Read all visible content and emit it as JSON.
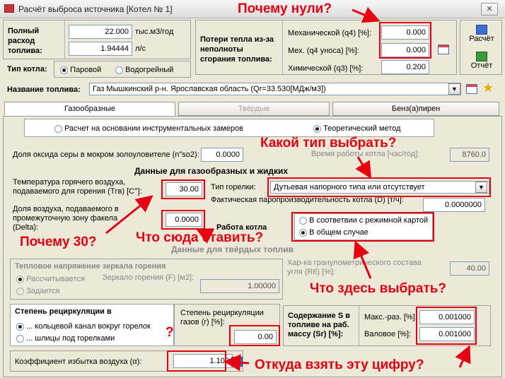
{
  "window": {
    "title": "Расчёт выброса источника [Котел № 1]",
    "close": "✕"
  },
  "fuel": {
    "label_line1": "Полный",
    "label_line2": "расход",
    "label_line3": "топлива:",
    "value1": "22.000",
    "unit1": "тыс.м3/год",
    "value2": "1.94444",
    "unit2": "л/с"
  },
  "boiler_type": {
    "label": "Тип котла:",
    "opt1": "Паровой",
    "opt2": "Водогрейный",
    "selected": "Паровой"
  },
  "heat_loss": {
    "label_line1": "Потери тепла из-за",
    "label_line2": "неполноты",
    "label_line3": "сгорания топлива:",
    "mech_label": "Механической (q4) [%]:",
    "mech_value": "0.000",
    "mech_carry_label": "Мех. (q4 уноса) [%]:",
    "mech_carry_value": "0.000",
    "chem_label": "Химической (q3) [%]:",
    "chem_value": "0.200"
  },
  "actions": {
    "calc": "Расчёт",
    "report": "Отчёт"
  },
  "fuel_name": {
    "label": "Название топлива:",
    "value": "Газ Мышкинский р-н. Ярославская область (Qr=33.530[МДж/м3])"
  },
  "tabs": [
    {
      "label": "Газообразные",
      "state": "active"
    },
    {
      "label": "Твёрдые",
      "state": "disabled"
    },
    {
      "label": "Бенз(а)пирен",
      "state": "normal"
    }
  ],
  "method": {
    "opt1": "Расчет на основании инструментальных замеров",
    "opt2": "Теоретический метод",
    "selected": "Теоретический метод"
  },
  "sulfur": {
    "label": "Доля оксида серы в мокром золоуловителе (n\"so2):",
    "value": "0.0000"
  },
  "work_time": {
    "label": "Время работы котла [час/год]:",
    "value": "8760.0"
  },
  "section_gas": "Данные для газообразных и жидких",
  "air_temp": {
    "label_line1": "Температура горячего воздуха,",
    "label_line2": "подаваемого для горения (Tгв) [C°]:",
    "value": "30.00"
  },
  "burner": {
    "label": "Тип горелки:",
    "value": "Дутьевая напорного типа или отсутствует"
  },
  "steam": {
    "label": "Фактическая паропроизводительность котла (D) [т/ч]:",
    "value": "0.0000000"
  },
  "delta": {
    "label_line1": "Доля воздуха, подаваемого в",
    "label_line2": "промежуточную зону факела",
    "label_line3": "(Delta):",
    "value": "0.0000"
  },
  "boiler_work": {
    "label": "Работа котла",
    "opt1": "В соответвии с режимной картой",
    "opt2": "В общем случае",
    "selected": "В общем случае"
  },
  "section_solid": "Данные для твёрдых топлив",
  "thermal": {
    "label": "Тепловое напряжение зеркала горения",
    "opt1": "Рассчитывается",
    "opt2": "Задается",
    "mirror_label": "Зеркало горения (F) [м2]:",
    "mirror_value": "1.00000"
  },
  "granulometry": {
    "label_line1": "Хар-ка гранулометрического состава",
    "label_line2": "угля (R6) [%]:",
    "value": "40.00"
  },
  "recirc": {
    "label": "Степень рециркуляции в",
    "opt1": "... кольцевой канал вокруг горелок",
    "opt2": "... шлицы под горелками",
    "degree_line1": "Степень рециркуляции",
    "degree_line2": "газов (r) [%]:",
    "value": "0.00"
  },
  "sulfur_content": {
    "label_line1": "Содержание S в",
    "label_line2": "топливе на раб.",
    "label_line3": "массу (Sr) [%]:",
    "max_label": "Макс.-раз. [%]:",
    "max_value": "0.001000",
    "gross_label": "Валовое [%]:",
    "gross_value": "0.001000"
  },
  "excess_air": {
    "label": "Коэффициент избытка воздуха (α):",
    "value": "1.100"
  },
  "annotations": {
    "why_zeros": "Почему нули?",
    "which_type": "Какой тип выбрать?",
    "why_30": "Почему 30?",
    "what_put": "Что сюда ставить?",
    "what_choose": "Что здесь выбрать?",
    "question": "?",
    "where_number": "Откуда взять эту цифру?"
  },
  "colors": {
    "annotation": "#e60012",
    "window_bg": "#ece9d8"
  }
}
